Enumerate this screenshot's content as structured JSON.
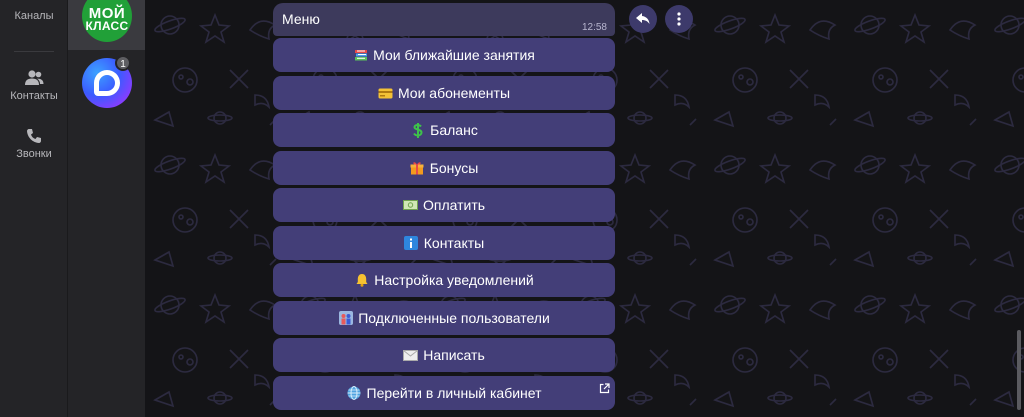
{
  "rail": {
    "channels_label": "Каналы",
    "contacts_label": "Контакты",
    "calls_label": "Звонки"
  },
  "chats": [
    {
      "avatar_line1": "МОЙ",
      "avatar_line2": "КЛАСС",
      "avatar_color": "#21a038"
    },
    {
      "unread_badge": "1"
    }
  ],
  "message": {
    "title": "Меню",
    "time": "12:58"
  },
  "keyboard": [
    {
      "label": "Мои ближайшие занятия",
      "icon": "books-icon"
    },
    {
      "label": "Мои абонементы",
      "icon": "card-icon"
    },
    {
      "label": "Баланс",
      "icon": "dollar-icon"
    },
    {
      "label": "Бонусы",
      "icon": "gift-icon"
    },
    {
      "label": "Оплатить",
      "icon": "money-icon"
    },
    {
      "label": "Контакты",
      "icon": "info-icon"
    },
    {
      "label": "Настройка уведомлений",
      "icon": "bell-icon"
    },
    {
      "label": "Подключенные пользователи",
      "icon": "people-icon"
    },
    {
      "label": "Написать",
      "icon": "envelope-icon"
    },
    {
      "label": "Перейти в личный кабинет",
      "icon": "globe-icon",
      "external": true
    }
  ],
  "colors": {
    "button_bg": "#433e78",
    "message_bg": "#3d3a5c",
    "accent_green": "#21a038"
  }
}
